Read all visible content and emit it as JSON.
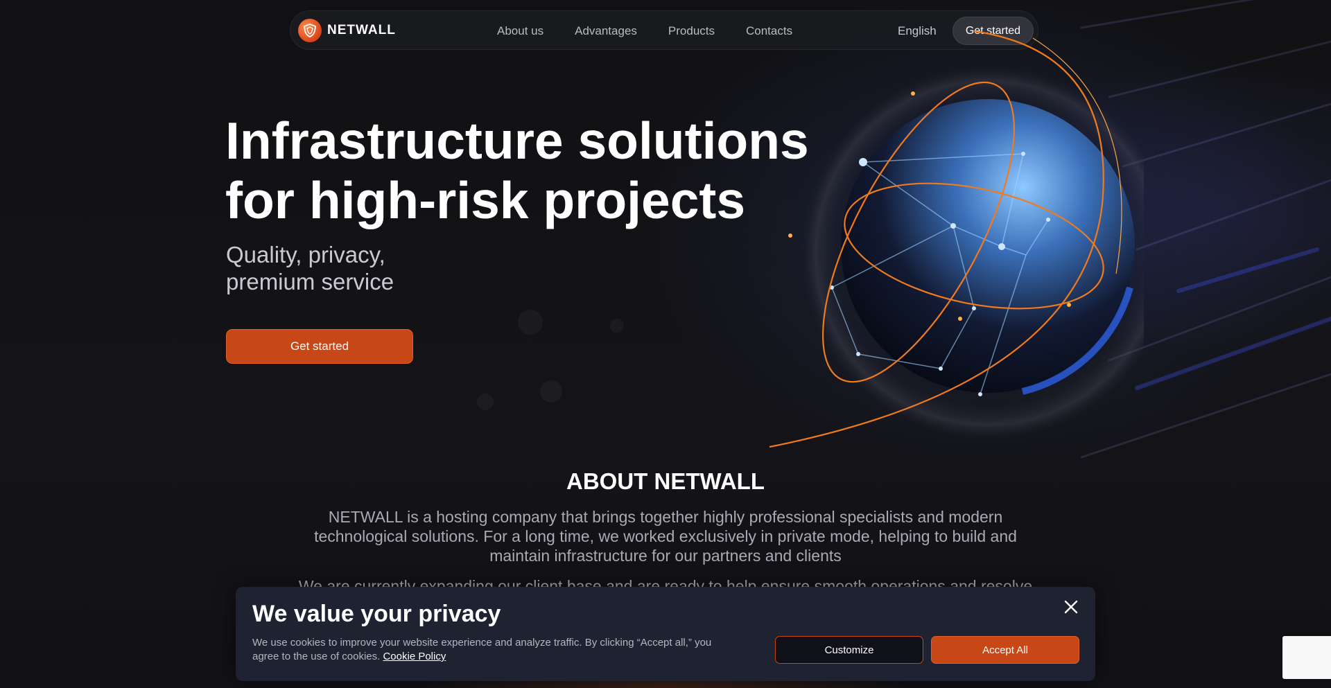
{
  "nav": {
    "brand": "NETWALL",
    "links": [
      "About us",
      "Advantages",
      "Products",
      "Contacts"
    ],
    "language": "English",
    "cta": "Get started"
  },
  "hero": {
    "title_line1": "Infrastructure solutions",
    "title_line2": "for high-risk projects",
    "subtitle_line1": "Quality, privacy,",
    "subtitle_line2": "premium service",
    "cta": "Get started"
  },
  "about": {
    "title": "ABOUT NETWALL",
    "paragraph1": "NETWALL is a hosting company that brings together highly professional specialists and modern technological solutions. For a long time, we worked exclusively in private mode, helping to build and maintain infrastructure for our partners and clients",
    "paragraph2": "We are currently expanding our client base and are ready to help ensure smooth operations and resolve"
  },
  "cookie": {
    "title": "We value your privacy",
    "text": "We use cookies to improve your website experience and analyze traffic. By clicking “Accept all,” you agree to the use of cookies.",
    "link": "Cookie Policy",
    "customize": "Customize",
    "accept": "Accept All"
  },
  "colors": {
    "accent": "#c84716",
    "background": "#111114",
    "cookie_bg": "#1f2230"
  },
  "icons": {
    "logo": "shield-logo-icon",
    "close": "close-icon",
    "globe": "globe-illustration"
  }
}
